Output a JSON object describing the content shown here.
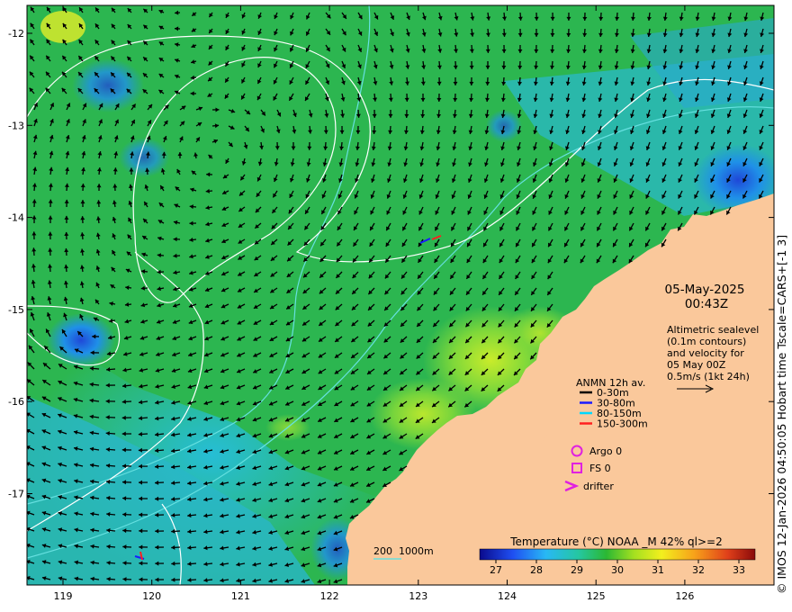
{
  "map": {
    "x_ticks": [
      "119",
      "120",
      "121",
      "122",
      "123",
      "124",
      "125",
      "126"
    ],
    "y_ticks": [
      "-12",
      "-13",
      "-14",
      "-15",
      "-16",
      "-17"
    ],
    "date": "05-May-2025",
    "time": "00:43Z",
    "description": [
      "Altimetric sealevel",
      "(0.1m contours)",
      "and velocity for",
      "05 May 00Z",
      "0.5m/s (1kt 24h)"
    ],
    "anmn_title": "ANMN 12h av.",
    "anmn_legend": [
      {
        "label": "0-30m",
        "color": "#000000"
      },
      {
        "label": "30-80m",
        "color": "#1a1aff"
      },
      {
        "label": "80-150m",
        "color": "#00d8ff"
      },
      {
        "label": "150-300m",
        "color": "#ff2020"
      }
    ],
    "symbol_legend": [
      {
        "label": "Argo 0",
        "icon": "circle-icon",
        "color": "#e020e0"
      },
      {
        "label": "FS 0",
        "icon": "square-icon",
        "color": "#e020e0"
      },
      {
        "label": "drifter",
        "icon": "chevron-icon",
        "color": "#e020e0"
      }
    ],
    "depth_legend": "200  1000m",
    "colorbar_title": "Temperature (°C) NOAA _M 42% ql>=2",
    "colorbar_ticks": [
      "27",
      "28",
      "29",
      "30",
      "31",
      "32",
      "33"
    ],
    "colorbar_range": [
      26.6,
      33.4
    ],
    "credit": "© IMOS 12-Jan-2026 04:50:05 Hobart time Tscale=CARS+[-1 3]",
    "colors": {
      "land": "#fac89b",
      "contour": "#ffffff",
      "isobath": "#66e0e0",
      "vector": "#000000"
    }
  }
}
